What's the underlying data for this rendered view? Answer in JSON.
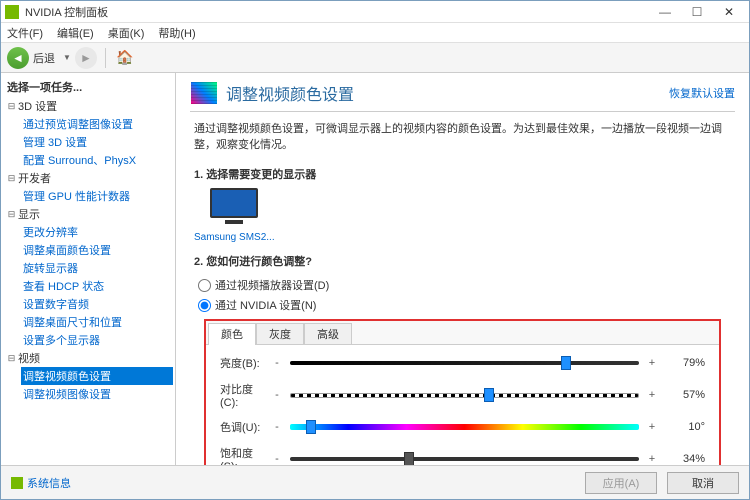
{
  "window": {
    "title": "NVIDIA 控制面板"
  },
  "menubar": {
    "file": "文件(F)",
    "edit": "编辑(E)",
    "desktop": "桌面(K)",
    "help": "帮助(H)"
  },
  "toolbar": {
    "back_label": "后退"
  },
  "sidebar": {
    "heading": "选择一项任务...",
    "groups": [
      {
        "label": "3D 设置",
        "items": [
          "通过预览调整图像设置",
          "管理 3D 设置",
          "配置 Surround、PhysX"
        ]
      },
      {
        "label": "开发者",
        "items": [
          "管理 GPU 性能计数器"
        ]
      },
      {
        "label": "显示",
        "items": [
          "更改分辨率",
          "调整桌面颜色设置",
          "旋转显示器",
          "查看 HDCP 状态",
          "设置数字音频",
          "调整桌面尺寸和位置",
          "设置多个显示器"
        ]
      },
      {
        "label": "视频",
        "items": [
          "调整视频颜色设置",
          "调整视频图像设置"
        ],
        "selected_index": 0
      }
    ]
  },
  "content": {
    "title": "调整视频颜色设置",
    "restore": "恢复默认设置",
    "desc": "通过调整视频颜色设置，可微调显示器上的视频内容的颜色设置。为达到最佳效果，一边播放一段视频一边调整，观察变化情况。",
    "step1": {
      "title": "1. 选择需要变更的显示器",
      "display_name": "Samsung SMS2..."
    },
    "step2": {
      "title": "2. 您如何进行颜色调整?",
      "options": [
        "通过视频播放器设置(D)",
        "通过 NVIDIA 设置(N)"
      ],
      "selected": 1,
      "tabs": [
        "颜色",
        "灰度",
        "高级"
      ],
      "active_tab": 0,
      "sliders": [
        {
          "label": "亮度(B):",
          "value": "79%",
          "pos": 79,
          "track": "brightness",
          "thumb": "blue"
        },
        {
          "label": "对比度(C):",
          "value": "57%",
          "pos": 57,
          "track": "contrast",
          "thumb": "blue"
        },
        {
          "label": "色调(U):",
          "value": "10°",
          "pos": 6,
          "track": "hue",
          "thumb": "blue"
        },
        {
          "label": "饱和度(S):",
          "value": "34%",
          "pos": 34,
          "track": "plain",
          "thumb": "gray"
        }
      ]
    }
  },
  "footer": {
    "sysinfo": "系统信息",
    "apply": "应用(A)",
    "cancel": "取消"
  }
}
